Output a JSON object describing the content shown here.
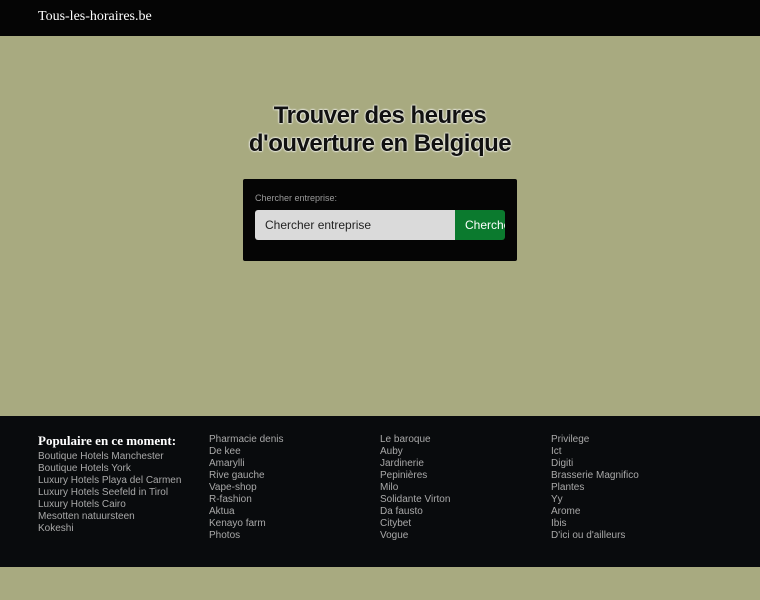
{
  "header": {
    "logo": "Tous-les-horaires.be"
  },
  "hero": {
    "title_line1": "Trouver des heures",
    "title_line2": "d'ouverture en Belgique"
  },
  "search": {
    "label": "Chercher entreprise:",
    "placeholder": "Chercher entreprise",
    "button": "Chercher"
  },
  "footer": {
    "heading": "Populaire en ce moment:",
    "col1": [
      "Boutique Hotels Manchester",
      "Boutique Hotels York",
      "Luxury Hotels Playa del Carmen",
      "Luxury Hotels Seefeld in Tirol",
      "Luxury Hotels Cairo",
      "Mesotten natuursteen",
      "Kokeshi"
    ],
    "col2": [
      "Pharmacie denis",
      "De kee",
      "Amarylli",
      "Rive gauche",
      "Vape-shop",
      "R-fashion",
      "Aktua",
      "Kenayo farm",
      "Photos"
    ],
    "col3": [
      "Le baroque",
      "Auby",
      "Jardinerie",
      "Pepinières",
      "Milo",
      "Solidante Virton",
      "Da fausto",
      "Citybet",
      "Vogue"
    ],
    "col4": [
      "Privilege",
      "Ict",
      "Digiti",
      "Brasserie Magnifico",
      "Plantes",
      "Yy",
      "Arome",
      "Ibis",
      "D'ici ou d'ailleurs"
    ]
  }
}
